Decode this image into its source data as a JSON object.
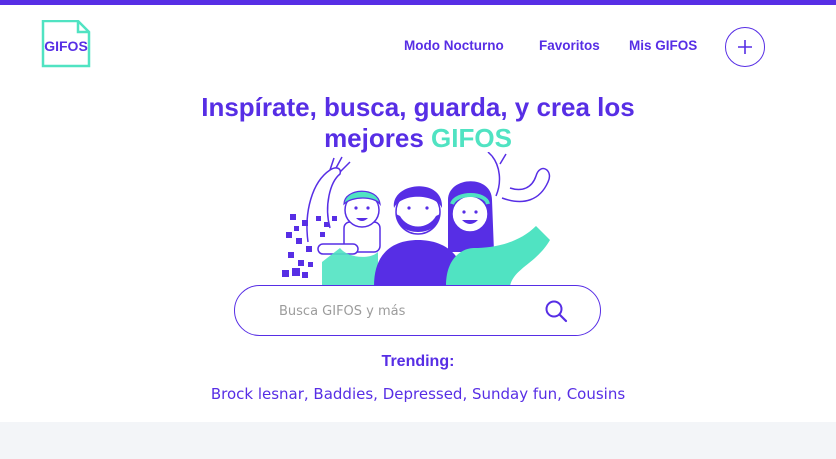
{
  "logo": {
    "text": "GIFOS"
  },
  "nav": {
    "dark_mode": "Modo Nocturno",
    "favorites": "Favoritos",
    "my_gifos": "Mis GIFOS"
  },
  "create_button": {
    "icon": "plus-icon"
  },
  "hero": {
    "title_main": "Inspírate, busca, guarda, y crea los mejores ",
    "title_accent": "GIFOS"
  },
  "search": {
    "placeholder": "Busca GIFOS y más",
    "icon": "search-icon"
  },
  "trending": {
    "title": "Trending:",
    "topics": "Brock lesnar, Baddies, Depressed, Sunday fun, Cousins"
  },
  "colors": {
    "primary": "#572ee5",
    "accent": "#50e3c2",
    "band": "#f3f5f8"
  }
}
